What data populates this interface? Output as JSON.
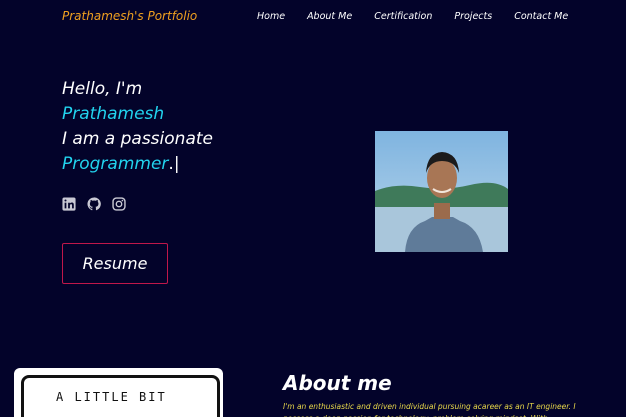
{
  "nav": {
    "brand": "Prathamesh's Portfolio",
    "links": [
      "Home",
      "About Me",
      "Certification",
      "Projects",
      "Contact Me"
    ]
  },
  "hero": {
    "greeting": "Hello, I'm",
    "name": "Prathamesh",
    "tagline": "I am a passionate",
    "role": "Programmer",
    "cursor": ".|"
  },
  "socials": [
    "linkedin-icon",
    "github-icon",
    "instagram-icon"
  ],
  "resume": {
    "label": "Resume"
  },
  "about": {
    "card_text": "A LITTLE BIT",
    "title": "About me",
    "text": "I'm an enthusiastic and driven individual pursuing acareer as an IT engineer. I possess a deep passion for technology, problem-solving mindset. With"
  },
  "colors": {
    "background": "#03032a",
    "brand": "#f0a020",
    "accent": "#22d3ee",
    "button_border": "#c0174a",
    "about_text": "#e8d84a"
  }
}
